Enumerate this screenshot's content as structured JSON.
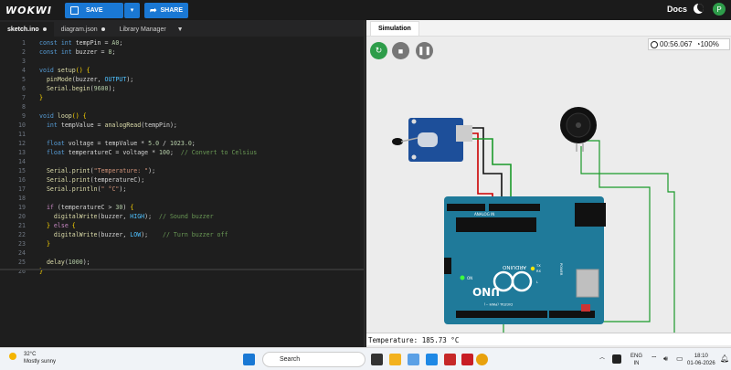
{
  "topbar": {
    "logo": "WOKWI",
    "save_label": "SAVE",
    "share_label": "SHARE",
    "docs_label": "Docs",
    "avatar_letter": "P"
  },
  "editor": {
    "tabs": [
      {
        "label": "sketch.ino",
        "modified": true
      },
      {
        "label": "diagram.json",
        "modified": true
      },
      {
        "label": "Library Manager"
      }
    ],
    "lines": [
      {
        "n": "1",
        "html": "<span class='kw'>const int</span> tempPin = <span class='num'>A0</span>;"
      },
      {
        "n": "2",
        "html": "<span class='kw'>const int</span> buzzer = <span class='num'>8</span>;"
      },
      {
        "n": "3",
        "html": ""
      },
      {
        "n": "4",
        "html": "<span class='kw'>void</span> <span class='fn'>setup</span><span class='br'>()</span> <span class='br'>{</span>"
      },
      {
        "n": "5",
        "html": "  <span class='fn'>pinMode</span>(buzzer, <span class='cst'>OUTPUT</span>);"
      },
      {
        "n": "6",
        "html": "  <span class='fn'>Serial</span>.<span class='fn'>begin</span>(<span class='num'>9600</span>);"
      },
      {
        "n": "7",
        "html": "<span class='br'>}</span>"
      },
      {
        "n": "8",
        "html": ""
      },
      {
        "n": "9",
        "html": "<span class='kw'>void</span> <span class='fn'>loop</span><span class='br'>()</span> <span class='br'>{</span>"
      },
      {
        "n": "10",
        "html": "  <span class='kw'>int</span> tempValue = <span class='fn'>analogRead</span>(tempPin);"
      },
      {
        "n": "11",
        "html": ""
      },
      {
        "n": "12",
        "html": "  <span class='kw'>float</span> voltage = tempValue * <span class='num'>5.0</span> / <span class='num'>1023.0</span>;"
      },
      {
        "n": "13",
        "html": "  <span class='kw'>float</span> temperatureC = voltage * <span class='num'>100</span>;  <span class='cm'>// Convert to Celsius</span>"
      },
      {
        "n": "14",
        "html": ""
      },
      {
        "n": "15",
        "html": "  <span class='fn'>Serial</span>.<span class='fn'>print</span>(<span class='str'>\"Temperature: \"</span>);"
      },
      {
        "n": "16",
        "html": "  <span class='fn'>Serial</span>.<span class='fn'>print</span>(temperatureC);"
      },
      {
        "n": "17",
        "html": "  <span class='fn'>Serial</span>.<span class='fn'>println</span>(<span class='str'>\" °C\"</span>);"
      },
      {
        "n": "18",
        "html": ""
      },
      {
        "n": "19",
        "html": "  <span class='pp'>if</span> (temperatureC &gt; <span class='num'>30</span>) <span class='br'>{</span>"
      },
      {
        "n": "20",
        "html": "    <span class='fn'>digitalWrite</span>(buzzer, <span class='cst'>HIGH</span>);  <span class='cm'>// Sound buzzer</span>"
      },
      {
        "n": "21",
        "html": "  <span class='br'>}</span> <span class='pp'>else</span> <span class='br'>{</span>"
      },
      {
        "n": "22",
        "html": "    <span class='fn'>digitalWrite</span>(buzzer, <span class='cst'>LOW</span>);    <span class='cm'>// Turn buzzer off</span>"
      },
      {
        "n": "23",
        "html": "  <span class='br'>}</span>"
      },
      {
        "n": "24",
        "html": ""
      },
      {
        "n": "25",
        "html": "  <span class='fn'>delay</span>(<span class='num'>1000</span>);"
      },
      {
        "n": "26",
        "html": "<span class='br'>}</span>"
      }
    ]
  },
  "simulation": {
    "tab_label": "Simulation",
    "timer": "00:56.067",
    "speed": "100%",
    "serial_output": "Temperature: 185.73 °C",
    "board_labels": {
      "brand": "ARDUINO",
      "model": "UNO",
      "analog_in": "ANALOG IN",
      "digital": "DIGITAL (PWM ~)",
      "power": "POWER",
      "on": "ON",
      "tx": "TX",
      "rx": "RX",
      "l": "L"
    }
  },
  "taskbar": {
    "weather_temp": "32°C",
    "weather_desc": "Mostly sunny",
    "search_placeholder": "Search",
    "lang1": "ENG",
    "lang2": "IN",
    "time": "18:10",
    "date": "01-06-2026"
  },
  "colors": {
    "accent": "#1a78d4",
    "run_green": "#2e9d4a",
    "board": "#1f7a9a"
  }
}
